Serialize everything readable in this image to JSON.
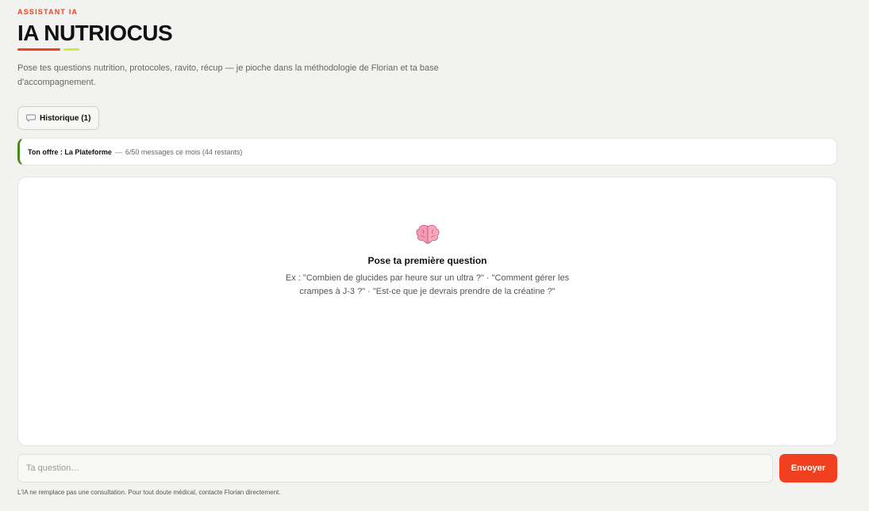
{
  "header": {
    "eyebrow": "ASSISTANT IA",
    "title": "IA NUTRIOCUS",
    "subtitle": "Pose tes questions nutrition, protocoles, ravito, récup — je pioche dans la méthodologie de Florian et ta base d'accompagnement."
  },
  "history_button": {
    "label": "Historique (1)",
    "icon": "speech-bubble-icon"
  },
  "plan": {
    "label": "Ton offre : La Plateforme",
    "separator": "—",
    "quota": "6/50 messages ce mois (44 restants)"
  },
  "empty_state": {
    "icon": "brain-icon",
    "title": "Pose ta première question",
    "examples": "Ex : \"Combien de glucides par heure sur un ultra ?\" · \"Comment gérer les crampes à J-3 ?\" · \"Est-ce que je devrais prendre de la créatine ?\""
  },
  "composer": {
    "placeholder": "Ta question…",
    "send_label": "Envoyer"
  },
  "footer": {
    "disclaimer": "L'IA ne remplace pas une consultation. Pour tout doute médical, contacte Florian directement."
  },
  "colors": {
    "accent": "#f0401f",
    "accent_secondary": "#c8f03c",
    "plan_border": "#4a8a1c",
    "background": "#f2f2f0"
  }
}
